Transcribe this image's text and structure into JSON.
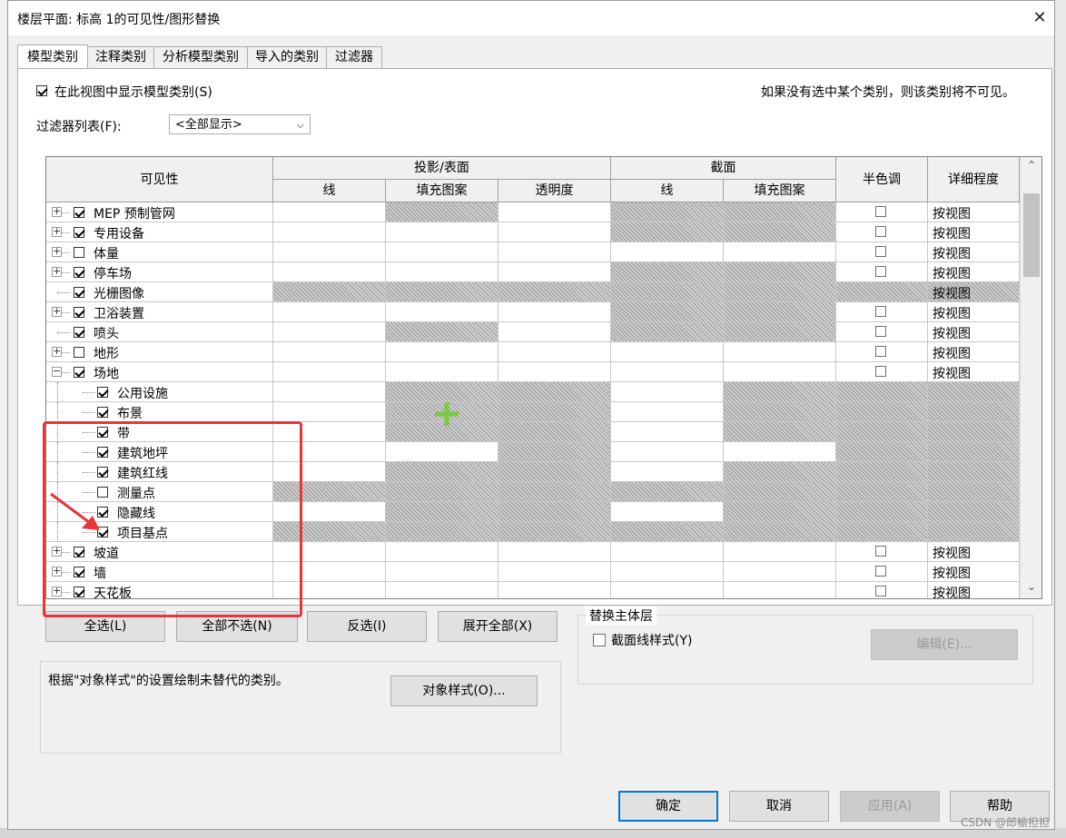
{
  "window": {
    "title": "楼层平面: 标高 1的可见性/图形替换",
    "close_symbol": "✕"
  },
  "tabs": [
    {
      "label": "模型类别",
      "active": true
    },
    {
      "label": "注释类别",
      "active": false
    },
    {
      "label": "分析模型类别",
      "active": false
    },
    {
      "label": "导入的类别",
      "active": false
    },
    {
      "label": "过滤器",
      "active": false
    }
  ],
  "options": {
    "show_categories_label": "在此视图中显示模型类别(S)",
    "show_categories_checked": true,
    "hint": "如果没有选中某个类别，则该类别将不可见。",
    "filter_list_label": "过滤器列表(F):",
    "filter_list_value": "<全部显示>",
    "filter_arrow": "⌵"
  },
  "table": {
    "headers": {
      "visibility": "可见性",
      "projection_surface": "投影/表面",
      "lines": "线",
      "fill_pattern": "填充图案",
      "transparency": "透明度",
      "cut": "截面",
      "cut_lines": "线",
      "cut_fill_pattern": "填充图案",
      "halftone": "半色调",
      "detail_level": "详细程度"
    },
    "expand_plus": "+",
    "expand_minus": "−",
    "rows": [
      {
        "name": "MEP 预制管网",
        "level": 0,
        "expander": "plus",
        "checked": true,
        "hatch": [
          0,
          1,
          0,
          1,
          1
        ],
        "halftone": true,
        "detail": "按视图"
      },
      {
        "name": "专用设备",
        "level": 0,
        "expander": "plus",
        "checked": true,
        "hatch": [
          0,
          0,
          0,
          1,
          1
        ],
        "halftone": true,
        "detail": "按视图"
      },
      {
        "name": "体量",
        "level": 0,
        "expander": "plus",
        "checked": false,
        "hatch": [
          0,
          0,
          0,
          0,
          0
        ],
        "halftone": true,
        "detail": "按视图"
      },
      {
        "name": "停车场",
        "level": 0,
        "expander": "plus",
        "checked": true,
        "hatch": [
          0,
          0,
          0,
          1,
          1
        ],
        "halftone": true,
        "detail": "按视图"
      },
      {
        "name": "光栅图像",
        "level": 0,
        "expander": "none",
        "checked": true,
        "hatch": [
          1,
          1,
          1,
          1,
          1
        ],
        "halftone": false,
        "halftone_hatch": true,
        "detail": "按视图"
      },
      {
        "name": "卫浴装置",
        "level": 0,
        "expander": "plus",
        "checked": true,
        "hatch": [
          0,
          0,
          0,
          1,
          1
        ],
        "halftone": true,
        "detail": "按视图"
      },
      {
        "name": "喷头",
        "level": 0,
        "expander": "none",
        "checked": true,
        "hatch": [
          0,
          1,
          0,
          1,
          1
        ],
        "halftone": true,
        "detail": "按视图"
      },
      {
        "name": "地形",
        "level": 0,
        "expander": "plus",
        "checked": false,
        "hatch": [
          0,
          0,
          0,
          0,
          0
        ],
        "halftone": true,
        "detail": "按视图"
      },
      {
        "name": "场地",
        "level": 0,
        "expander": "minus",
        "checked": true,
        "hatch": [
          0,
          0,
          0,
          0,
          0
        ],
        "halftone": true,
        "detail": "按视图"
      },
      {
        "name": "公用设施",
        "level": 1,
        "expander": "none",
        "checked": true,
        "hatch": [
          0,
          1,
          1,
          0,
          1
        ],
        "halftone": false,
        "halftone_hatch": true,
        "detail": ""
      },
      {
        "name": "布景",
        "level": 1,
        "expander": "none",
        "checked": true,
        "hatch": [
          0,
          1,
          1,
          0,
          1
        ],
        "halftone": false,
        "halftone_hatch": true,
        "detail": ""
      },
      {
        "name": "带",
        "level": 1,
        "expander": "none",
        "checked": true,
        "hatch": [
          0,
          1,
          1,
          0,
          1
        ],
        "halftone": false,
        "halftone_hatch": true,
        "detail": ""
      },
      {
        "name": "建筑地坪",
        "level": 1,
        "expander": "none",
        "checked": true,
        "hatch": [
          0,
          0,
          1,
          0,
          0
        ],
        "halftone": false,
        "halftone_hatch": true,
        "detail": ""
      },
      {
        "name": "建筑红线",
        "level": 1,
        "expander": "none",
        "checked": true,
        "hatch": [
          0,
          1,
          1,
          0,
          1
        ],
        "halftone": false,
        "halftone_hatch": true,
        "detail": ""
      },
      {
        "name": "测量点",
        "level": 1,
        "expander": "none",
        "checked": false,
        "hatch": [
          1,
          1,
          1,
          1,
          1
        ],
        "halftone": false,
        "halftone_hatch": true,
        "detail": ""
      },
      {
        "name": "隐藏线",
        "level": 1,
        "expander": "none",
        "checked": true,
        "hatch": [
          0,
          1,
          1,
          0,
          1
        ],
        "halftone": false,
        "halftone_hatch": true,
        "detail": ""
      },
      {
        "name": "项目基点",
        "level": 1,
        "expander": "none",
        "checked": true,
        "hatch": [
          1,
          1,
          1,
          1,
          1
        ],
        "halftone": false,
        "halftone_hatch": true,
        "detail": ""
      },
      {
        "name": "坡道",
        "level": 0,
        "expander": "plus",
        "checked": true,
        "hatch": [
          0,
          0,
          0,
          0,
          0
        ],
        "halftone": true,
        "detail": "按视图"
      },
      {
        "name": "墙",
        "level": 0,
        "expander": "plus",
        "checked": true,
        "hatch": [
          0,
          0,
          0,
          0,
          0
        ],
        "halftone": true,
        "detail": "按视图"
      },
      {
        "name": "天花板",
        "level": 0,
        "expander": "plus",
        "checked": true,
        "hatch": [
          0,
          0,
          0,
          0,
          0
        ],
        "halftone": true,
        "detail": "按视图"
      }
    ]
  },
  "scrollbar": {
    "up": "⌃",
    "down": "⌄"
  },
  "buttons": {
    "select_all": "全选(L)",
    "select_none": "全部不选(N)",
    "invert": "反选(I)",
    "expand_all": "展开全部(X)"
  },
  "host_layers": {
    "title": "替换主体层",
    "cut_line_styles": "截面线样式(Y)",
    "cut_line_styles_checked": false,
    "edit": "编辑(E)..."
  },
  "object_styles": {
    "note": "根据\"对象样式\"的设置绘制未替代的类别。",
    "button": "对象样式(O)..."
  },
  "footer": {
    "ok": "确定",
    "cancel": "取消",
    "apply": "应用(A)",
    "help": "帮助"
  },
  "watermark": "CSDN @郎榆担担",
  "colors": {
    "annotation_red": "#e8343a",
    "cursor_green": "#7ac943",
    "default_button_border": "#0078d7"
  }
}
